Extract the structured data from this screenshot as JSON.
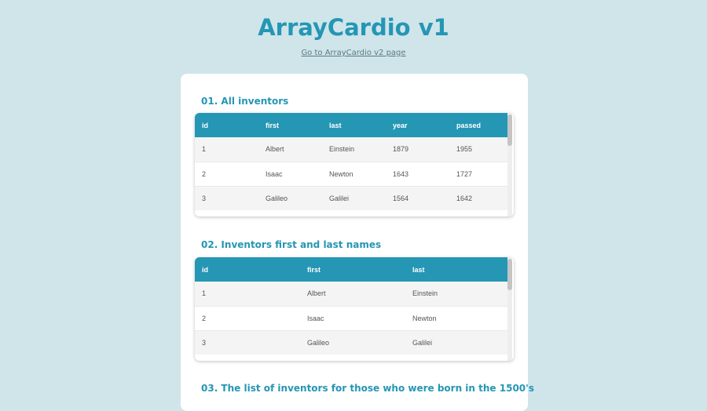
{
  "header": {
    "title": "ArrayCardio v1",
    "v2_link": "Go to ArrayCardio v2 page"
  },
  "sections": [
    {
      "title": "01. All inventors",
      "columns": [
        "id",
        "first",
        "last",
        "year",
        "passed"
      ],
      "rows": [
        [
          "1",
          "Albert",
          "Einstein",
          "1879",
          "1955"
        ],
        [
          "2",
          "Isaac",
          "Newton",
          "1643",
          "1727"
        ],
        [
          "3",
          "Galileo",
          "Galilei",
          "1564",
          "1642"
        ]
      ]
    },
    {
      "title": "02. Inventors first and last names",
      "columns": [
        "id",
        "first",
        "last"
      ],
      "rows": [
        [
          "1",
          "Albert",
          "Einstein"
        ],
        [
          "2",
          "Isaac",
          "Newton"
        ],
        [
          "3",
          "Galileo",
          "Galilei"
        ]
      ]
    },
    {
      "title": "03. The list of inventors for those who were born in the 1500's"
    }
  ],
  "colors": {
    "accent": "#2596b4",
    "background": "#cfe5ea"
  }
}
